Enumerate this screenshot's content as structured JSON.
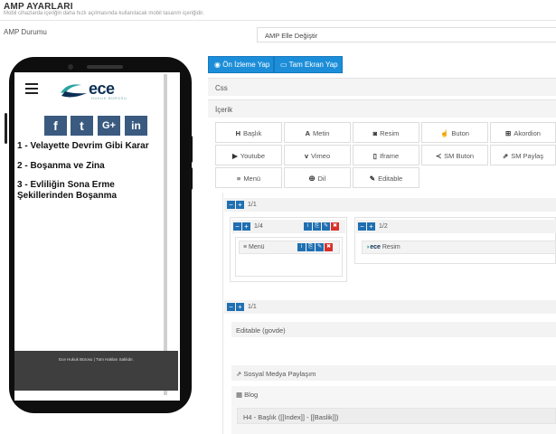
{
  "header": {
    "title": "AMP AYARLARI",
    "subtitle": "Mobil cihazlarda içeriğin daha hızlı açılmasında kullanılacak mobil tasarım içeriğidir."
  },
  "amp_status": {
    "label": "AMP Durumu",
    "selected": "AMP Elle Değiştir"
  },
  "preview": {
    "logo_text": "ece",
    "logo_sub": "HUKUK BÜROSU",
    "social": [
      "f",
      "t",
      "G+",
      "in"
    ],
    "menu_items": [
      "1 - Velayette Devrim Gibi Karar",
      "2 - Boşanma ve Zina",
      "3 - Evliliğin Sona Erme Şekillerinden Boşanma"
    ],
    "footer": "Ece Hukuk Bürosu | Tüm Hakları Saklıdır."
  },
  "actions": {
    "preview": "Ön İzleme Yap",
    "fullscreen": "Tam Ekran Yap"
  },
  "sections": {
    "css": "Css",
    "content": "İçerik"
  },
  "toolbox": [
    [
      "Başlık",
      "Metin",
      "Resim",
      "Buton",
      "Akordion"
    ],
    [
      "Youtube",
      "Vimeo",
      "Iframe",
      "SM Buton",
      "SM Paylaş"
    ],
    [
      "Menü",
      "Dil",
      "Editable"
    ]
  ],
  "builder": {
    "row1_label": "1/1",
    "col_a_label": "1/4",
    "col_b_label": "1/2",
    "menu_elem": "Menü",
    "image_elem_logo": "ece",
    "image_elem": "Resim",
    "row2_label": "1/1",
    "editable": "Editable (govde)",
    "social_share": "Sosyal Medya Paylaşım",
    "blog": "Blog",
    "blog_item": "H4 - Başlık ([[Index]] - [[Baslik]])"
  }
}
